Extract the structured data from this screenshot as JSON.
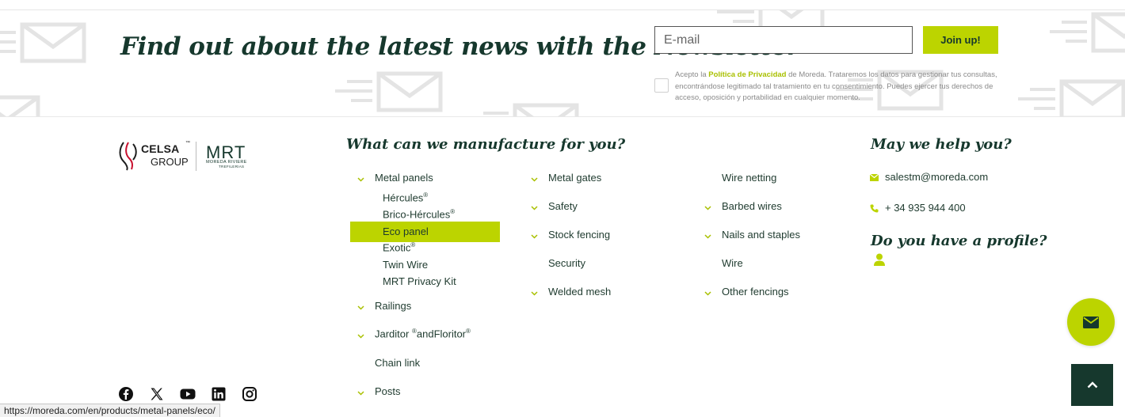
{
  "newsletter": {
    "title": "Find out about the latest news with the Newsletter",
    "email_placeholder": "E-mail",
    "email_value": "",
    "join_label": "Join up!",
    "consent_before": "Acepto la ",
    "consent_link": "Política de Privacidad",
    "consent_after": " de Moreda. Trataremos los datos para gestionar tus consultas, encontrándose legitimado tal tratamiento en tu consentimiento. Puedes ejercer tus derechos de acceso, oposición y portabilidad en cualquier momento."
  },
  "logo": {
    "celsa": "CELSA",
    "tm": "™",
    "group": "GROUP",
    "mrt": "MRT",
    "mrt_sub": "MOREDA RIVIERE",
    "mrt_sub2": "TREFILERIAS"
  },
  "products": {
    "title": "What can we manufacture for you?",
    "col1": {
      "metal_panels": "Metal panels",
      "sub": {
        "hercules": "Hércules",
        "brico_hercules": "Brico-Hércules",
        "eco_panel": "Eco panel",
        "exotic": "Exotic",
        "twin_wire": "Twin Wire",
        "mrt_privacy_kit": "MRT Privacy Kit"
      },
      "registered": "®",
      "railings": "Railings",
      "jarditor_a": "Jarditor ",
      "jarditor_b": "andFloritor",
      "chain_link": "Chain link",
      "posts": "Posts"
    },
    "col2": [
      "Metal gates",
      "Safety",
      "Stock fencing",
      "Security",
      "Welded mesh"
    ],
    "col3": [
      "Wire netting",
      "Barbed wires",
      "Nails and staples",
      "Wire",
      "Other fencings"
    ]
  },
  "help": {
    "title": "May we help you?",
    "email": "salestm@moreda.com",
    "phone": "+ 34 935 944 400",
    "profile_title": "Do you have a profile?"
  },
  "social": [
    "facebook-icon",
    "x-icon",
    "youtube-icon",
    "linkedin-icon",
    "instagram-icon"
  ],
  "status_bar": {
    "url": "https://moreda.com/en/products/metal-panels/eco/"
  },
  "colors": {
    "accent": "#bcd400",
    "dark_green": "#16382d",
    "text": "#1e3a2e"
  }
}
